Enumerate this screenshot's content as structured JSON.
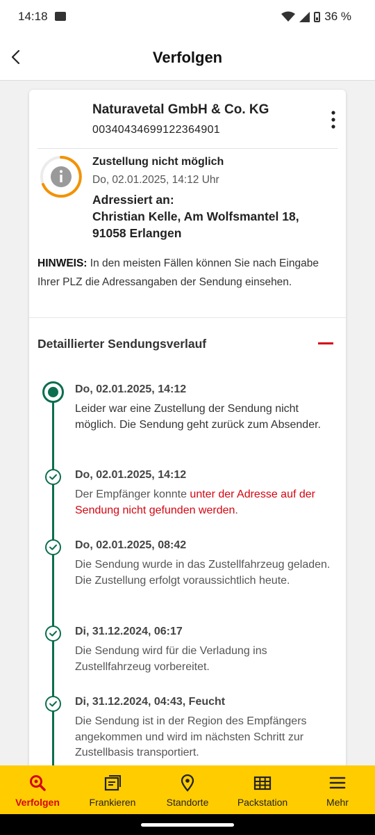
{
  "status_bar": {
    "time": "14:18",
    "battery": "36 %"
  },
  "header": {
    "title": "Verfolgen"
  },
  "shipment": {
    "sender": "Naturavetal GmbH & Co. KG",
    "tracking_number": "00340434699122364901",
    "status_title": "Zustellung nicht möglich",
    "status_time": "Do, 02.01.2025, 14:12 Uhr",
    "address_label": "Adressiert an:",
    "address_line1": "Christian Kelle, Am Wolfsmantel 18,",
    "address_line2": "91058 Erlangen",
    "hint_label": "HINWEIS:",
    "hint_text": " In den meisten Fällen können Sie nach Eingabe Ihrer PLZ die Adressangaben der Sendung einsehen."
  },
  "history": {
    "title": "Detaillierter Sendungsverlauf",
    "events": [
      {
        "date": "Do, 02.01.2025, 14:12",
        "text": "Leider war eine Zustellung der Sendung nicht möglich. Die Sendung geht zurück zum Absender."
      },
      {
        "date": "Do, 02.01.2025, 14:12",
        "text_prefix": "Der Empfänger konnte ",
        "text_highlight": "unter der Adresse auf der Sendung nicht gefunden werden",
        "text_suffix": "."
      },
      {
        "date": "Do, 02.01.2025, 08:42",
        "text": "Die Sendung wurde in das Zustellfahrzeug geladen. Die Zustellung erfolgt voraussichtlich heute."
      },
      {
        "date": "Di, 31.12.2024, 06:17",
        "text": "Die Sendung wird für die Verladung ins Zustellfahrzeug vorbereitet."
      },
      {
        "date": "Di, 31.12.2024, 04:43, Feucht",
        "text": "Die Sendung ist in der Region des Empfängers angekommen und wird im nächsten Schritt zur Zustellbasis transportiert."
      }
    ]
  },
  "bottom_nav": {
    "items": [
      {
        "label": "Verfolgen",
        "icon": "search-icon",
        "active": true
      },
      {
        "label": "Frankieren",
        "icon": "stamp-icon"
      },
      {
        "label": "Standorte",
        "icon": "location-pin-icon"
      },
      {
        "label": "Packstation",
        "icon": "packstation-icon"
      },
      {
        "label": "Mehr",
        "icon": "hamburger-menu-icon"
      }
    ]
  },
  "colors": {
    "brand_yellow": "#ffcc00",
    "brand_red": "#d40511",
    "timeline_green": "#0b6e4f",
    "status_orange": "#f39200"
  }
}
